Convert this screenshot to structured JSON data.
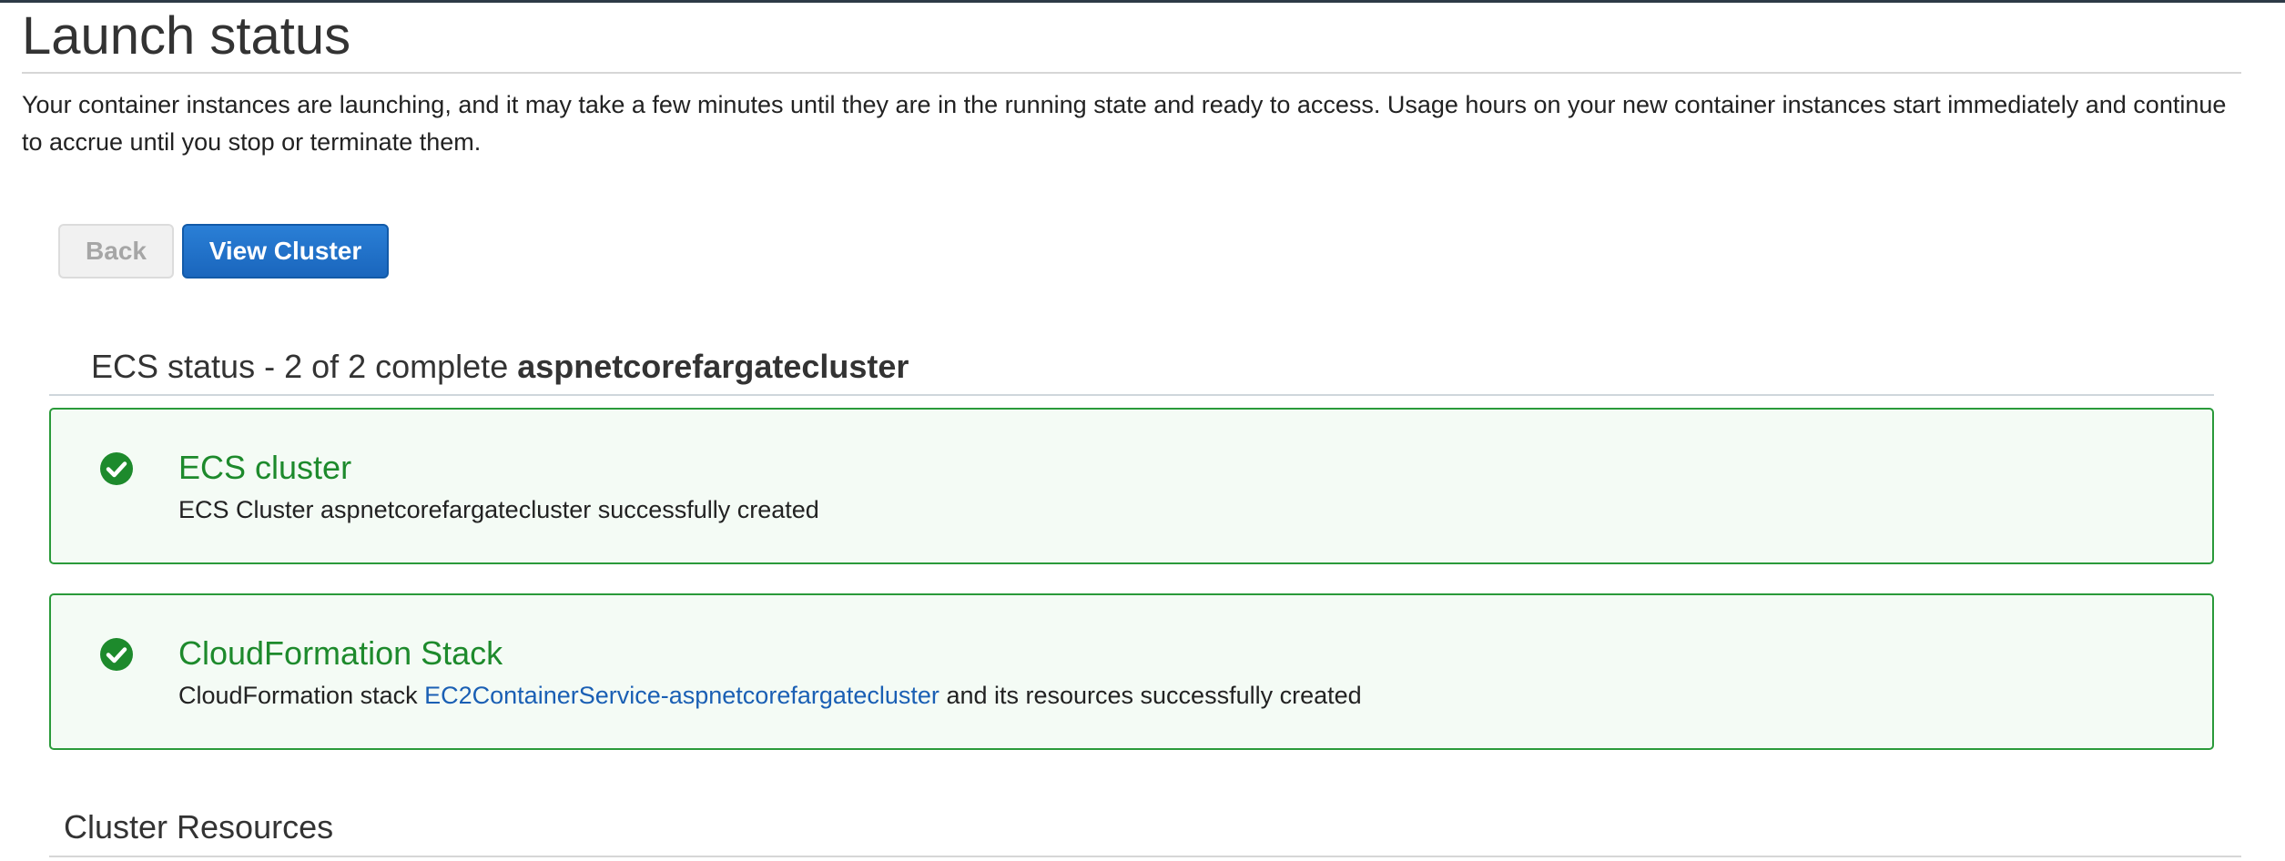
{
  "page": {
    "title": "Launch status",
    "intro": "Your container instances are launching, and it may take a few minutes until they are in the running state and ready to access. Usage hours on your new container instances start immediately and continue to accrue until you stop or terminate them."
  },
  "actions": {
    "back_label": "Back",
    "view_cluster_label": "View Cluster"
  },
  "ecs_status": {
    "heading_prefix": "ECS status - 2 of 2 complete",
    "cluster_name": "aspnetcorefargatecluster",
    "items": [
      {
        "title": "ECS cluster",
        "description": "ECS Cluster aspnetcorefargatecluster successfully created",
        "status_icon": "check-circle-icon"
      },
      {
        "title": "CloudFormation Stack",
        "description_prefix": "CloudFormation stack",
        "link_text": "EC2ContainerService-aspnetcorefargatecluster",
        "description_suffix": "and its resources successfully created",
        "status_icon": "check-circle-icon"
      }
    ]
  },
  "cluster_resources": {
    "heading": "Cluster Resources"
  },
  "colors": {
    "success": "#1d8a2c",
    "primary_button": "#1a66bd",
    "link": "#1a5fb4"
  }
}
